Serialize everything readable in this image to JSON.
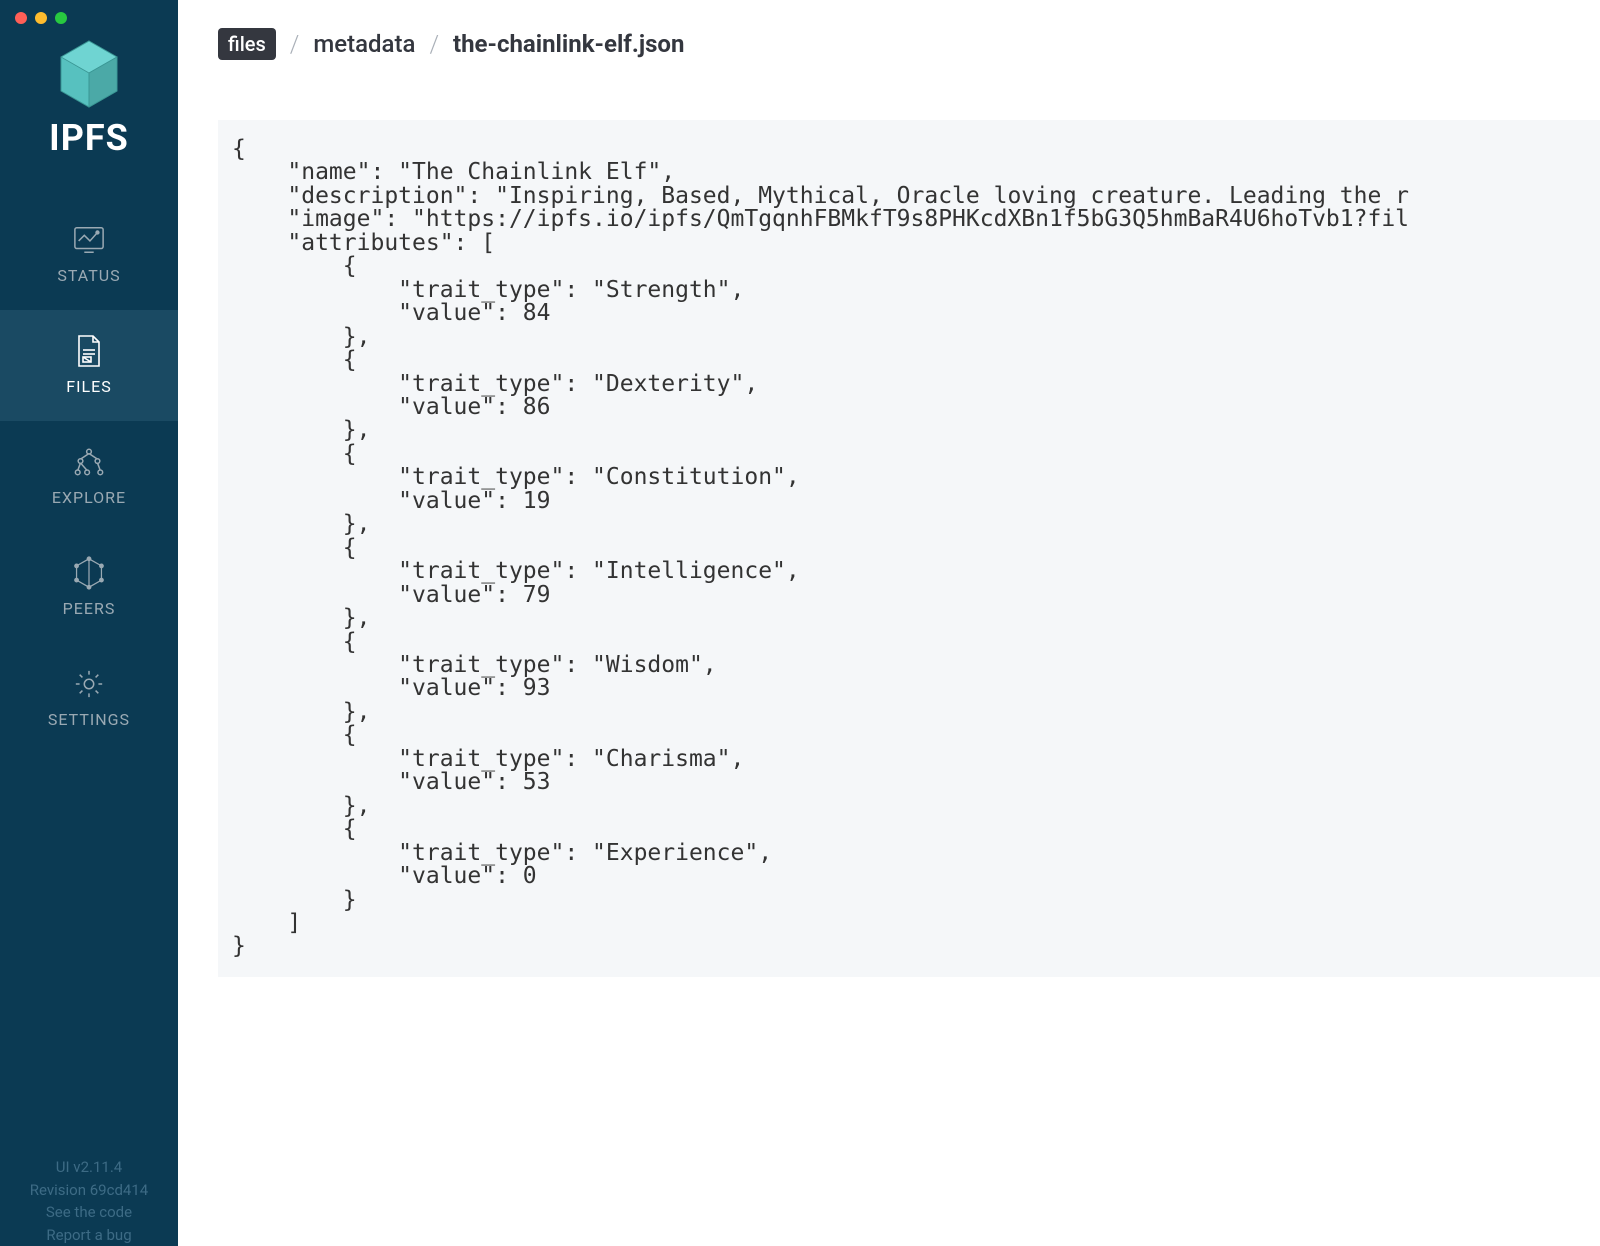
{
  "app": {
    "name": "IPFS"
  },
  "nav": {
    "status": "STATUS",
    "files": "FILES",
    "explore": "EXPLORE",
    "peers": "PEERS",
    "settings": "SETTINGS"
  },
  "footer": {
    "ui_version": "UI v2.11.4",
    "revision": "Revision 69cd414",
    "see_code": "See the code",
    "report_bug": "Report a bug"
  },
  "breadcrumb": {
    "root": "files",
    "folder": "metadata",
    "file": "the-chainlink-elf.json"
  },
  "file_json": {
    "name": "The Chainlink Elf",
    "description": "Inspiring, Based, Mythical, Oracle loving creature. Leading the r",
    "image": "https://ipfs.io/ipfs/QmTgqnhFBMkfT9s8PHKcdXBn1f5bG3Q5hmBaR4U6hoTvb1?fil",
    "attributes": [
      {
        "trait_type": "Strength",
        "value": 84
      },
      {
        "trait_type": "Dexterity",
        "value": 86
      },
      {
        "trait_type": "Constitution",
        "value": 19
      },
      {
        "trait_type": "Intelligence",
        "value": 79
      },
      {
        "trait_type": "Wisdom",
        "value": 93
      },
      {
        "trait_type": "Charisma",
        "value": 53
      },
      {
        "trait_type": "Experience",
        "value": 0
      }
    ]
  }
}
